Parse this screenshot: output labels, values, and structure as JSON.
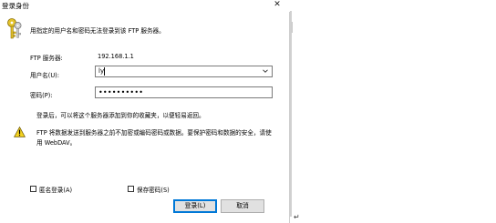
{
  "window": {
    "title": "登录身份",
    "close_glyph": "✕"
  },
  "header": {
    "message": "用指定的用户名和密码无法登录到该 FTP 服务器。"
  },
  "server": {
    "label": "FTP 服务器:",
    "value": "192.168.1.1"
  },
  "username": {
    "label": "用户名(U):",
    "value": "ly"
  },
  "password": {
    "label": "密码(P):",
    "value": "••••••••••"
  },
  "hint": {
    "text": "登录后，可以将这个服务器添加到你的收藏夹，以便轻易返回。"
  },
  "warning": {
    "line1": "FTP 将数据发送到服务器之前不加密或编码密码或数据。要保护密码和数据的安全，请使",
    "line2": "用 WebDAV。"
  },
  "options": {
    "anonymous_label": "匿名登录(A)",
    "save_password_label": "保存密码(S)"
  },
  "buttons": {
    "login": "登录(L)",
    "cancel": "取消"
  },
  "misc": {
    "return_mark": "↵"
  },
  "icons": {
    "keys": "keys-icon",
    "warning": "warning-icon",
    "dropdown": "chevron-down-icon"
  },
  "colors": {
    "accent": "#0078d7",
    "keys": "#e4c32a",
    "warning": "#f4d21f"
  }
}
